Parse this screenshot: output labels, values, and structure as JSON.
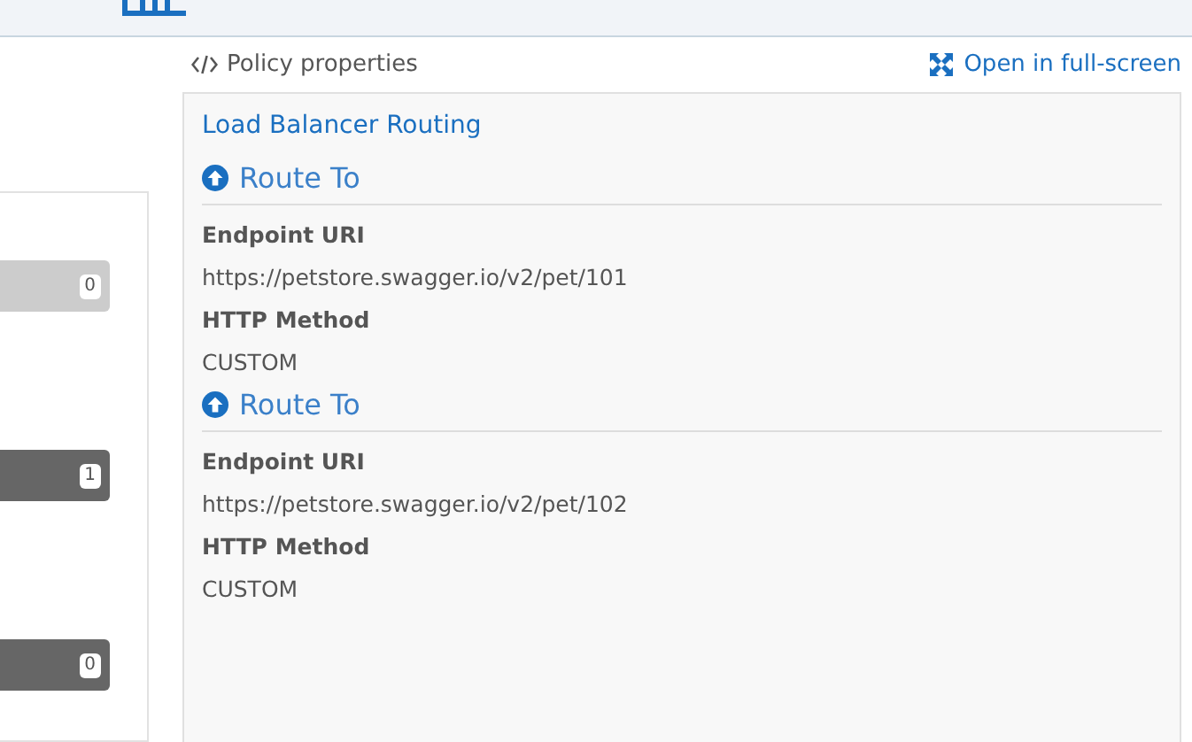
{
  "side_bars": [
    {
      "disabled": true,
      "count": "0"
    },
    {
      "disabled": false,
      "count": "1"
    },
    {
      "disabled": false,
      "count": "0"
    }
  ],
  "header": {
    "title": "Policy properties",
    "fullscreen_link": "Open in full-screen"
  },
  "policy": {
    "name": "Load Balancer Routing",
    "routes": [
      {
        "title": "Route To",
        "fields": [
          {
            "label": "Endpoint URI",
            "value": "https://petstore.swagger.io/v2/pet/101"
          },
          {
            "label": "HTTP Method",
            "value": "CUSTOM"
          }
        ]
      },
      {
        "title": "Route To",
        "fields": [
          {
            "label": "Endpoint URI",
            "value": "https://petstore.swagger.io/v2/pet/102"
          },
          {
            "label": "HTTP Method",
            "value": "CUSTOM"
          }
        ]
      }
    ]
  }
}
